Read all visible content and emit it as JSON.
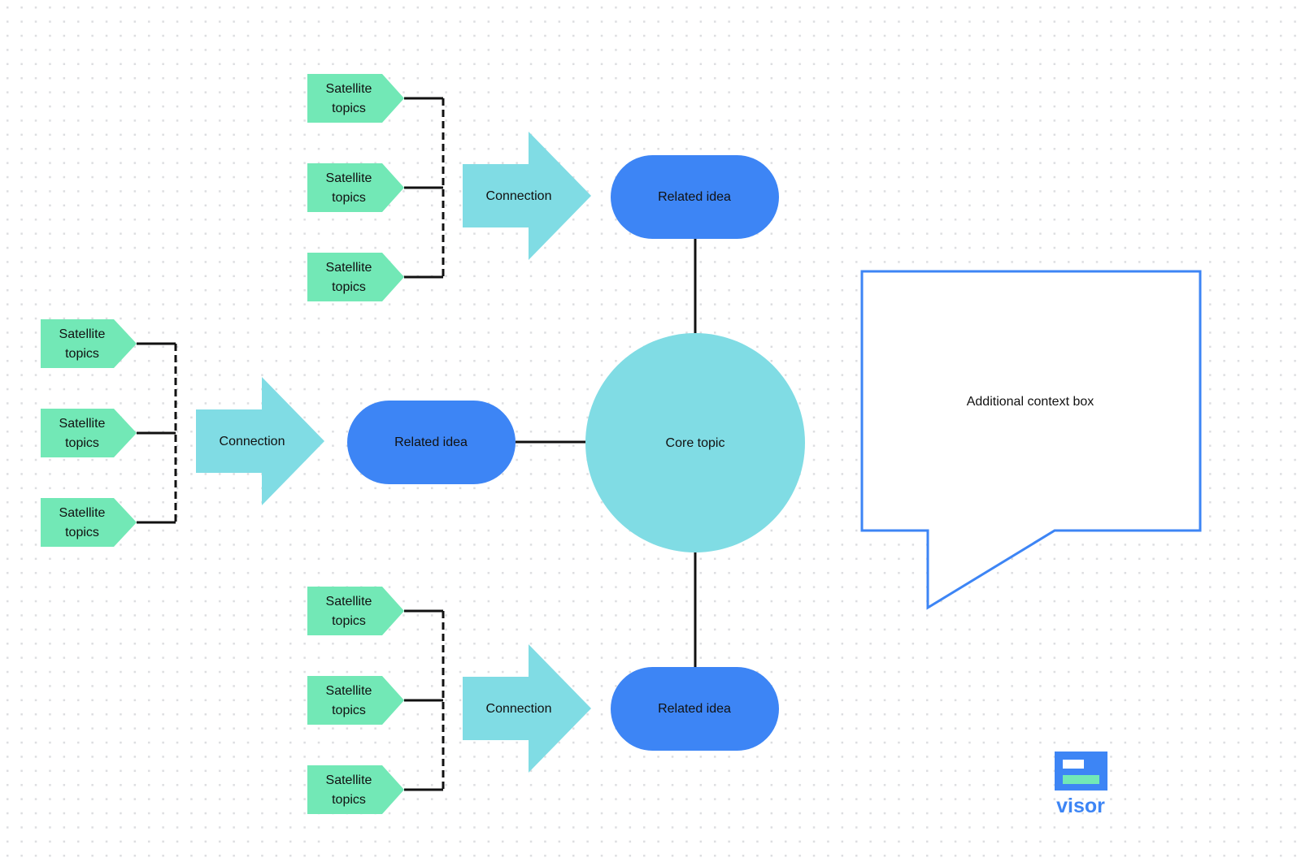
{
  "colors": {
    "satellite": "#72e8b6",
    "connection": "#80dce4",
    "related": "#3d85f5",
    "core": "#80dce4",
    "callout_border": "#3d85f5",
    "line": "#111111",
    "grid_dot": "#dcdde0"
  },
  "core": {
    "label": "Core topic"
  },
  "branches": [
    {
      "id": "top",
      "connection": "Connection",
      "related": "Related idea",
      "satellites": [
        "Satellite\ntopics",
        "Satellite\ntopics",
        "Satellite\ntopics"
      ]
    },
    {
      "id": "left",
      "connection": "Connection",
      "related": "Related idea",
      "satellites": [
        "Satellite\ntopics",
        "Satellite\ntopics",
        "Satellite\ntopics"
      ]
    },
    {
      "id": "bottom",
      "connection": "Connection",
      "related": "Related idea",
      "satellites": [
        "Satellite\ntopics",
        "Satellite\ntopics",
        "Satellite\ntopics"
      ]
    }
  ],
  "callout": {
    "label": "Additional context box"
  },
  "logo": {
    "text": "visor"
  }
}
